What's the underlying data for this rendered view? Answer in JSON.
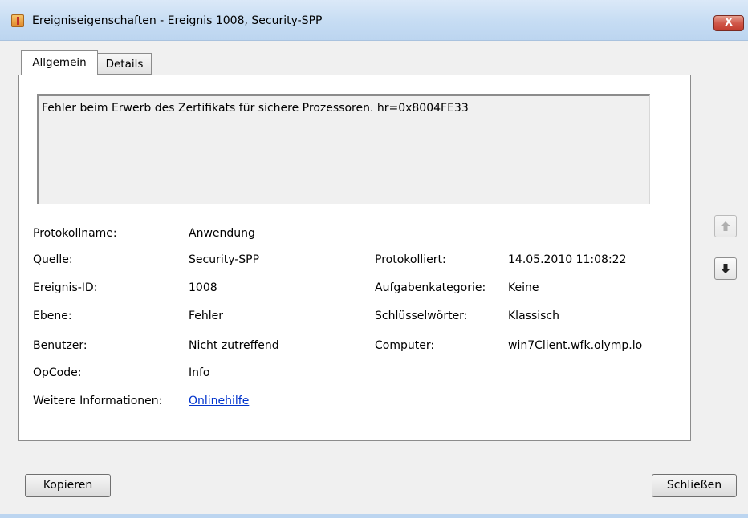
{
  "window": {
    "title": "Ereigniseigenschaften - Ereignis 1008, Security-SPP",
    "close_glyph": "X"
  },
  "tabs": [
    {
      "label": "Allgemein",
      "active": true
    },
    {
      "label": "Details",
      "active": false
    }
  ],
  "general": {
    "description": "Fehler beim Erwerb des Zertifikats für sichere Prozessoren. hr=0x8004FE33",
    "fields": {
      "log_name": {
        "label": "Protokollname:",
        "value": "Anwendung"
      },
      "source": {
        "label": "Quelle:",
        "value": "Security-SPP"
      },
      "event_id": {
        "label": "Ereignis-ID:",
        "value": "1008"
      },
      "level": {
        "label": "Ebene:",
        "value": "Fehler"
      },
      "user": {
        "label": "Benutzer:",
        "value": "Nicht zutreffend"
      },
      "opcode": {
        "label": "OpCode:",
        "value": "Info"
      },
      "more_info": {
        "label": "Weitere Informationen:",
        "value": "Onlinehilfe"
      },
      "logged": {
        "label": "Protokolliert:",
        "value": "14.05.2010 11:08:22"
      },
      "task_category": {
        "label": "Aufgabenkategorie:",
        "value": "Keine"
      },
      "keywords": {
        "label": "Schlüsselwörter:",
        "value": "Klassisch"
      },
      "computer": {
        "label": "Computer:",
        "value": "win7Client.wfk.olymp.lo"
      }
    }
  },
  "navigation": {
    "up_icon": "arrow-up-icon",
    "down_icon": "arrow-down-icon"
  },
  "buttons": {
    "copy": "Kopieren",
    "close": "Schließen"
  },
  "colors": {
    "link": "#0033cc",
    "title_bar": "#c6dcf3",
    "close_button": "#c23c2e"
  }
}
